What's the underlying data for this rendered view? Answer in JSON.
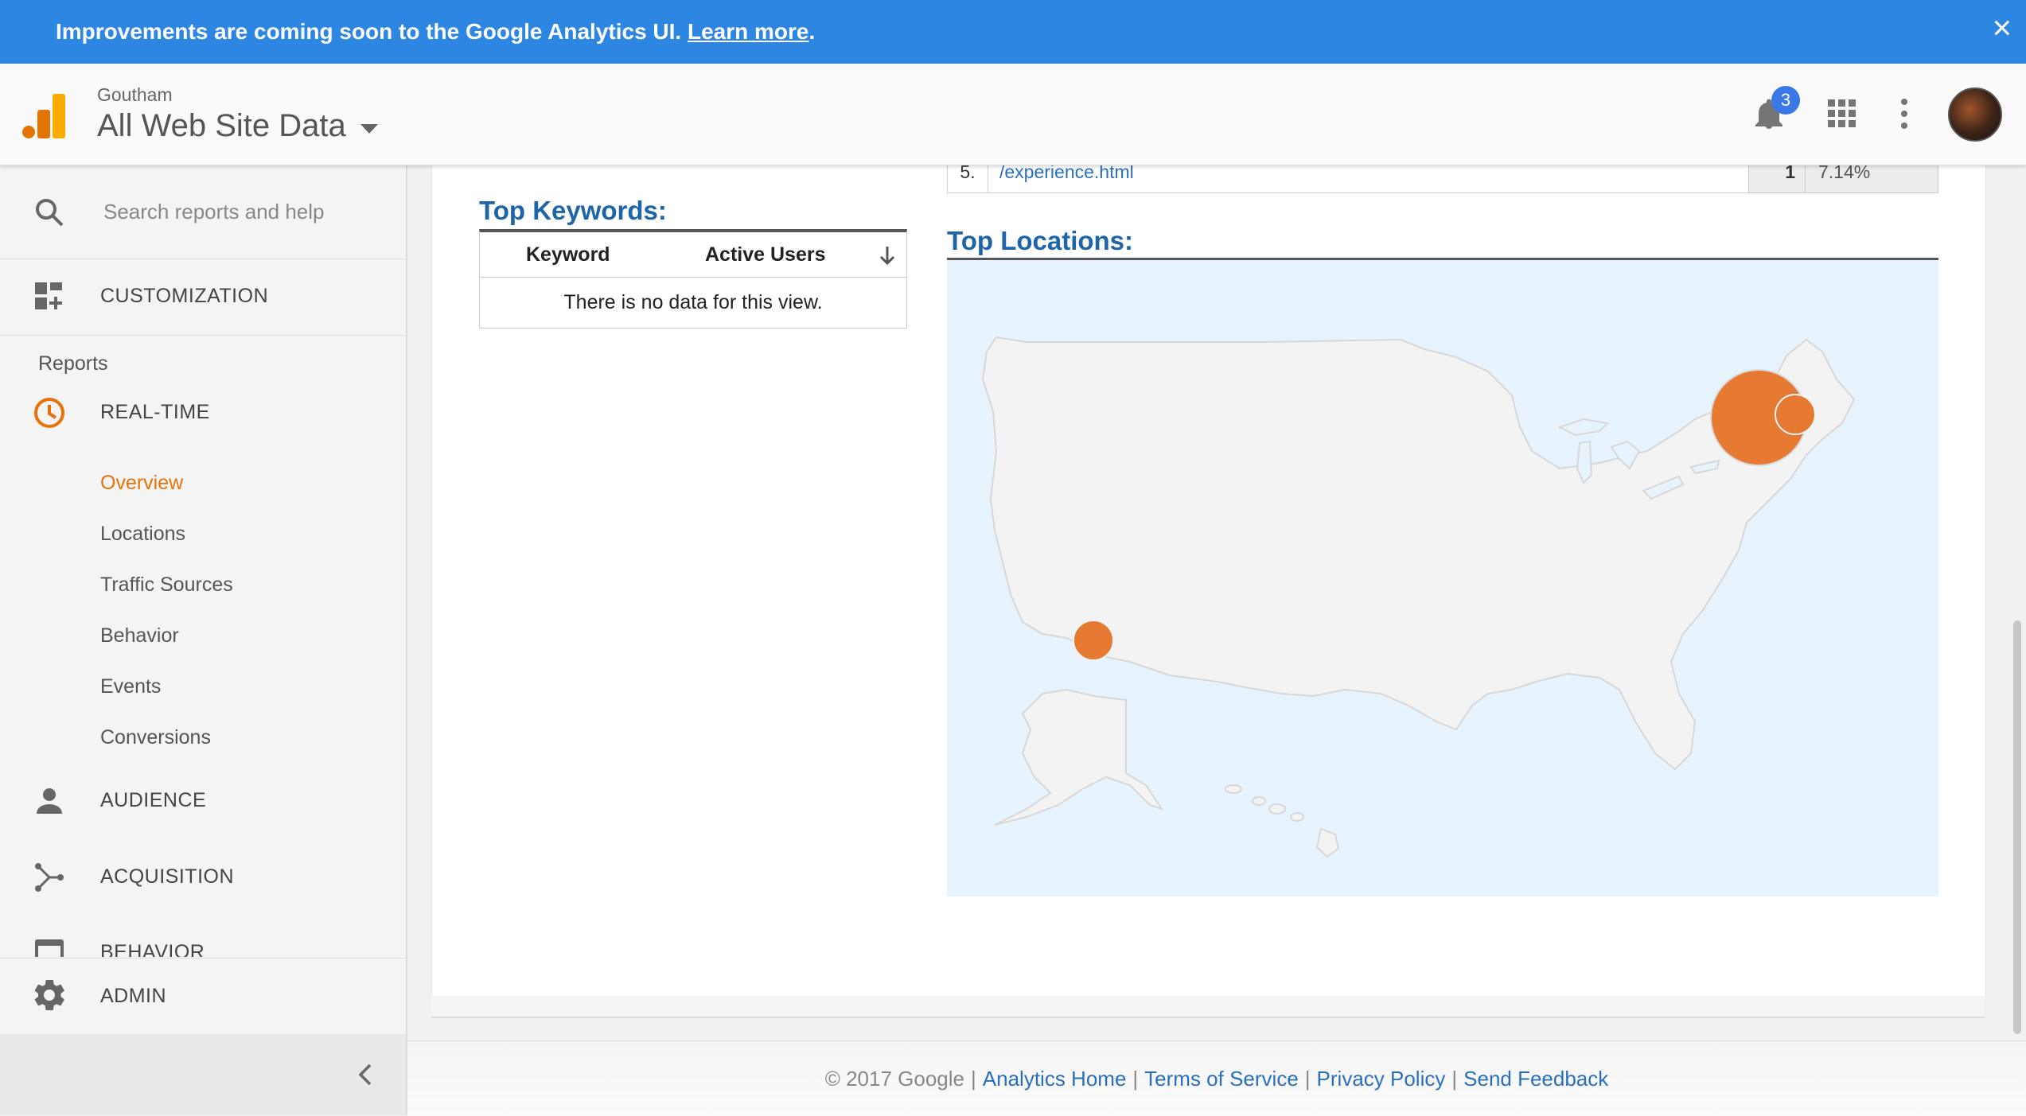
{
  "banner": {
    "message": "Improvements are coming soon to the Google Analytics UI.",
    "link": "Learn more",
    "after": ".",
    "close": "×"
  },
  "header": {
    "account": "Goutham",
    "view": "All Web Site Data",
    "notification_count": "3"
  },
  "sidebar": {
    "search_placeholder": "Search reports and help",
    "customization": "CUSTOMIZATION",
    "reports_label": "Reports",
    "realtime": "REAL-TIME",
    "realtime_items": [
      "Overview",
      "Locations",
      "Traffic Sources",
      "Behavior",
      "Events",
      "Conversions"
    ],
    "audience": "AUDIENCE",
    "acquisition": "ACQUISITION",
    "behavior": "BEHAVIOR",
    "admin": "ADMIN"
  },
  "top_pages_row": {
    "rank": "5.",
    "page": "/experience.html",
    "users": "1",
    "percent": "7.14%"
  },
  "top_keywords": {
    "title": "Top Keywords:",
    "columns": [
      "Keyword",
      "Active Users"
    ],
    "empty_message": "There is no data for this view."
  },
  "top_locations": {
    "title": "Top Locations:"
  },
  "colors": {
    "banner": "#2d87e2",
    "accent_orange": "#e8710a",
    "link_blue": "#2a6fbd",
    "title_blue": "#1e64a8",
    "map_water": "#e8f4fd",
    "map_land": "#f3f3f3",
    "bubble": "#e67a32"
  },
  "footer": {
    "copyright": "© 2017 Google",
    "links": [
      "Analytics Home",
      "Terms of Service",
      "Privacy Policy",
      "Send Feedback"
    ]
  }
}
